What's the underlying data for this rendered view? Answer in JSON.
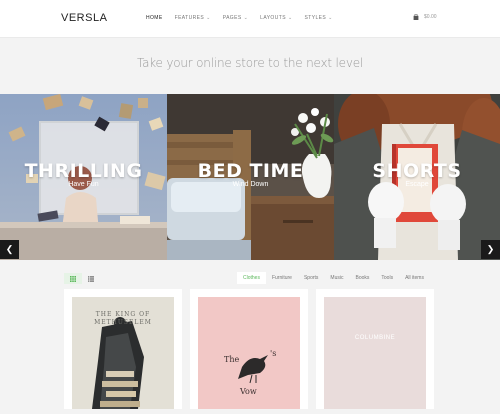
{
  "header": {
    "logo": "VERSLA",
    "nav": [
      {
        "label": "HOME",
        "active": true,
        "dropdown": false
      },
      {
        "label": "FEATURES",
        "active": false,
        "dropdown": true
      },
      {
        "label": "PAGES",
        "active": false,
        "dropdown": true
      },
      {
        "label": "LAYOUTS",
        "active": false,
        "dropdown": true
      },
      {
        "label": "STYLES",
        "active": false,
        "dropdown": true
      }
    ],
    "cart_total": "$0.00"
  },
  "tagline": "Take your online store to the next level",
  "slides": [
    {
      "title": "THRILLING",
      "subtitle": "Have Fun"
    },
    {
      "title": "BED TIME",
      "subtitle": "Wind Down"
    },
    {
      "title": "SHORTS",
      "subtitle": "Escape"
    }
  ],
  "slider_controls": {
    "prev": "❮",
    "next": "❯"
  },
  "filters": [
    "Clothes",
    "Furniture",
    "Sports",
    "Music",
    "Books",
    "Tools",
    "All items"
  ],
  "active_filter": "Clothes",
  "products": [
    {
      "cover_text": "THE KING OF METHUSELEM"
    },
    {
      "cover_text_1": "The",
      "cover_text_2": "'s",
      "cover_text_3": "Vow"
    },
    {
      "cover_text": "COLUMBINE"
    }
  ],
  "colors": {
    "accent": "#5cb85c",
    "header_bg": "#ffffff",
    "page_bg": "#f3f3f3"
  }
}
